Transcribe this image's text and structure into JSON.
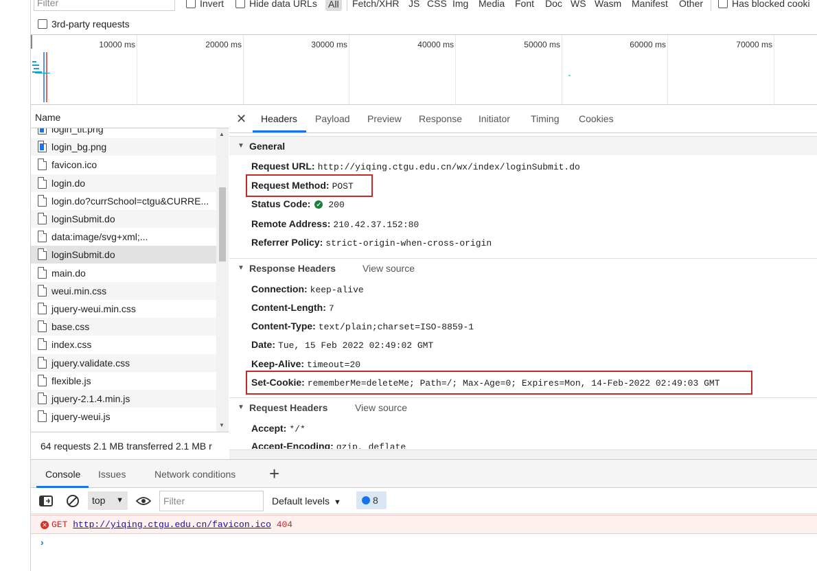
{
  "filterbar": {
    "filter_placeholder": "Filter",
    "invert_label": "Invert",
    "hide_data_urls_label": "Hide data URLs",
    "types": [
      "All",
      "Fetch/XHR",
      "JS",
      "CSS",
      "Img",
      "Media",
      "Font",
      "Doc",
      "WS",
      "Wasm",
      "Manifest",
      "Other"
    ],
    "has_blocked_label": "Has blocked cooki",
    "third_party_label": "3rd-party requests"
  },
  "timeline": {
    "labels": [
      "10000 ms",
      "20000 ms",
      "30000 ms",
      "40000 ms",
      "50000 ms",
      "60000 ms",
      "70000 ms"
    ]
  },
  "request_list": {
    "header": "Name",
    "rows": [
      {
        "name": "login_tit.png",
        "icon": "image-file-icon"
      },
      {
        "name": "login_bg.png",
        "icon": "image-file-icon"
      },
      {
        "name": "favicon.ico",
        "icon": "file-icon"
      },
      {
        "name": "login.do",
        "icon": "file-icon"
      },
      {
        "name": "login.do?currSchool=ctgu&CURRE...",
        "icon": "file-icon"
      },
      {
        "name": "loginSubmit.do",
        "icon": "file-icon"
      },
      {
        "name": "data:image/svg+xml;...",
        "icon": "svg-file-icon"
      },
      {
        "name": "loginSubmit.do",
        "icon": "file-icon"
      },
      {
        "name": "main.do",
        "icon": "file-icon"
      },
      {
        "name": "weui.min.css",
        "icon": "file-icon"
      },
      {
        "name": "jquery-weui.min.css",
        "icon": "file-icon"
      },
      {
        "name": "base.css",
        "icon": "file-icon"
      },
      {
        "name": "index.css",
        "icon": "file-icon"
      },
      {
        "name": "jquery.validate.css",
        "icon": "file-icon"
      },
      {
        "name": "flexible.js",
        "icon": "file-icon"
      },
      {
        "name": "jquery-2.1.4.min.js",
        "icon": "file-icon"
      },
      {
        "name": "jquery-weui.js",
        "icon": "file-icon"
      }
    ],
    "selected_index": 7,
    "status": "64 requests  2.1 MB transferred  2.1 MB r"
  },
  "details": {
    "tabs": [
      "Headers",
      "Payload",
      "Preview",
      "Response",
      "Initiator",
      "Timing",
      "Cookies"
    ],
    "general": {
      "title": "General",
      "rows": [
        {
          "key": "Request URL:",
          "value": "http://yiqing.ctgu.edu.cn/wx/index/loginSubmit.do"
        },
        {
          "key": "Request Method:",
          "value": "POST"
        },
        {
          "key": "Status Code:",
          "value": "200"
        },
        {
          "key": "Remote Address:",
          "value": "210.42.37.152:80"
        },
        {
          "key": "Referrer Policy:",
          "value": "strict-origin-when-cross-origin"
        }
      ]
    },
    "response_headers": {
      "title": "Response Headers",
      "view_source": "View source",
      "rows": [
        {
          "key": "Connection:",
          "value": "keep-alive"
        },
        {
          "key": "Content-Length:",
          "value": "7"
        },
        {
          "key": "Content-Type:",
          "value": "text/plain;charset=ISO-8859-1"
        },
        {
          "key": "Date:",
          "value": "Tue, 15 Feb 2022 02:49:02 GMT"
        },
        {
          "key": "Keep-Alive:",
          "value": "timeout=20"
        },
        {
          "key": "Set-Cookie:",
          "value": "rememberMe=deleteMe; Path=/; Max-Age=0; Expires=Mon, 14-Feb-2022 02:49:03 GMT"
        }
      ]
    },
    "request_headers": {
      "title": "Request Headers",
      "view_source": "View source",
      "rows": [
        {
          "key": "Accept:",
          "value": "*/*"
        },
        {
          "key": "Accept-Encoding:",
          "value": "gzip, deflate"
        }
      ]
    },
    "highlight_color": "#c62828"
  },
  "drawer": {
    "tabs": [
      "Console",
      "Issues",
      "Network conditions"
    ],
    "context": "top",
    "filter_placeholder": "Filter",
    "levels": "Default levels",
    "message_count": "8",
    "error": {
      "method": "GET",
      "url": "http://yiqing.ctgu.edu.cn/favicon.ico",
      "status": "404"
    },
    "prompt": "›"
  }
}
